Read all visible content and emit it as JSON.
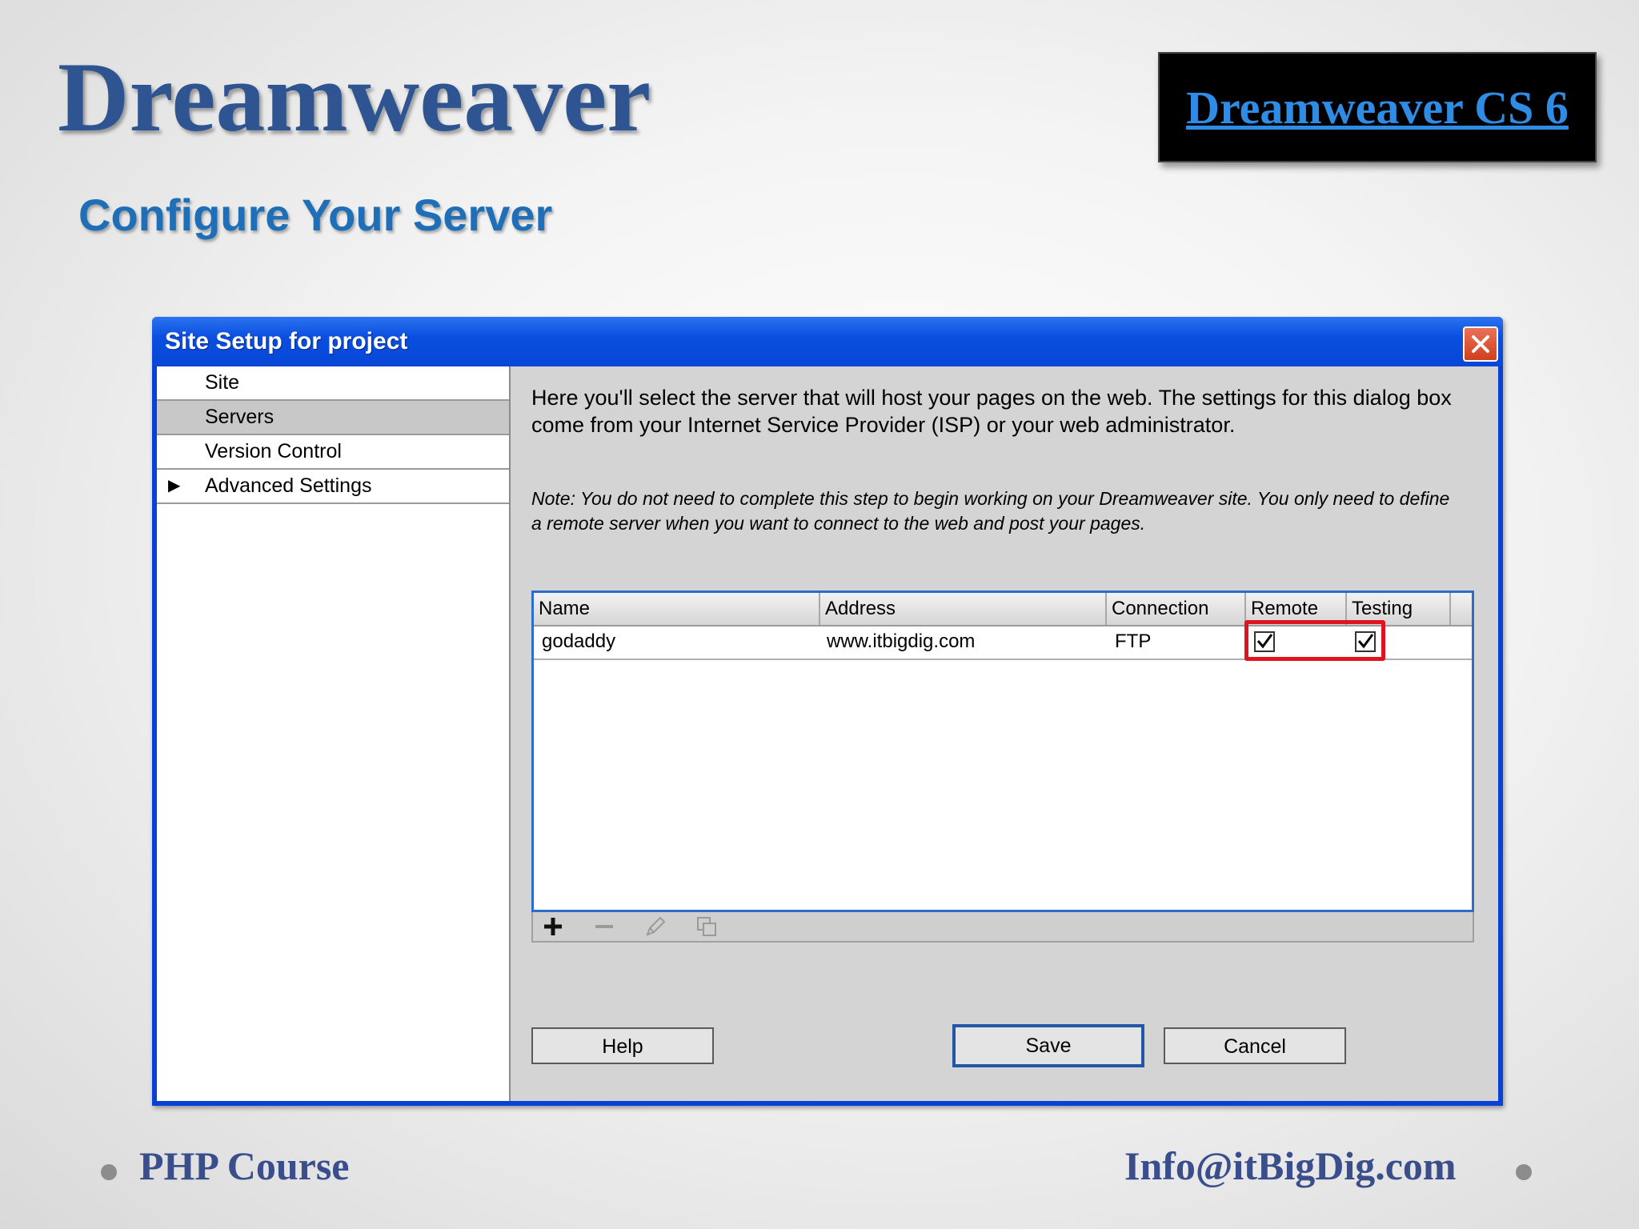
{
  "slide": {
    "title": "Dreamweaver",
    "version_badge": "Dreamweaver CS 6",
    "subtitle": "Configure Your Server",
    "footer_left": "PHP Course",
    "footer_right": "Info@itBigDig.com"
  },
  "dialog": {
    "title": "Site Setup for project",
    "nav": [
      {
        "label": "Site"
      },
      {
        "label": "Servers",
        "selected": true
      },
      {
        "label": "Version Control"
      },
      {
        "label": "Advanced Settings",
        "expandable": true
      }
    ],
    "description": "Here you'll select the server that will host your pages on the web. The settings for this dialog box come from your Internet Service Provider (ISP) or your web administrator.",
    "note": "Note: You do not need to complete this step to begin working on your Dreamweaver site. You only need to define a remote server when you want to connect to the web and post your pages.",
    "table": {
      "columns": [
        "Name",
        "Address",
        "Connection",
        "Remote",
        "Testing"
      ],
      "rows": [
        {
          "name": "godaddy",
          "address": "www.itbigdig.com",
          "connection": "FTP",
          "remote": true,
          "testing": true
        }
      ]
    },
    "toolbar_icons": [
      "add-icon",
      "remove-icon",
      "edit-icon",
      "duplicate-icon"
    ],
    "buttons": {
      "help": "Help",
      "save": "Save",
      "cancel": "Cancel"
    }
  },
  "colors": {
    "title_blue": "#2e5592",
    "titlebar_blue": "#0a4fe0",
    "highlight_red": "#e0141e"
  }
}
